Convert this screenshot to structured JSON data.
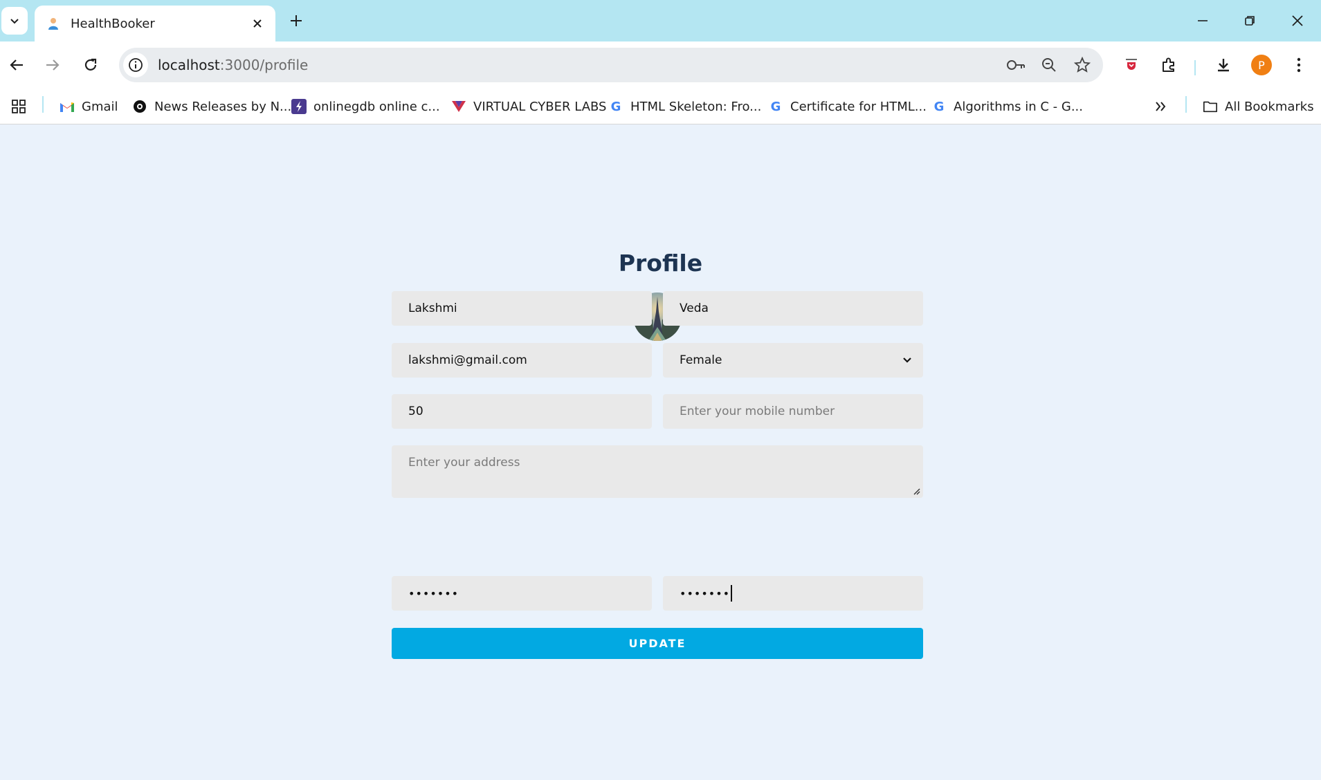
{
  "browser": {
    "tab": {
      "title": "HealthBooker"
    },
    "address": {
      "host": "localhost",
      "path": ":3000/profile"
    },
    "profile_initial": "P",
    "bookmarks": [
      {
        "label": "Gmail",
        "icon": "gmail-icon"
      },
      {
        "label": "News Releases by N...",
        "icon": "news-icon"
      },
      {
        "label": "onlinegdb online c...",
        "icon": "onlinegdb-icon"
      },
      {
        "label": "VIRTUAL CYBER LABS",
        "icon": "vcl-icon"
      },
      {
        "label": "HTML Skeleton: Fro...",
        "icon": "google-icon"
      },
      {
        "label": "Certificate for HTML...",
        "icon": "google-icon"
      },
      {
        "label": "Algorithms in C - G...",
        "icon": "google-icon"
      }
    ],
    "all_bookmarks": "All Bookmarks"
  },
  "profile": {
    "title": "Profile",
    "first_name": "Lakshmi",
    "last_name": "Veda",
    "email": "lakshmi@gmail.com",
    "gender": "Female",
    "age": "50",
    "mobile_placeholder": "Enter your mobile number",
    "address_placeholder": "Enter your address",
    "password_mask": "•••••••",
    "confirm_password_mask": "•••••••",
    "update_label": "UPDATE"
  }
}
